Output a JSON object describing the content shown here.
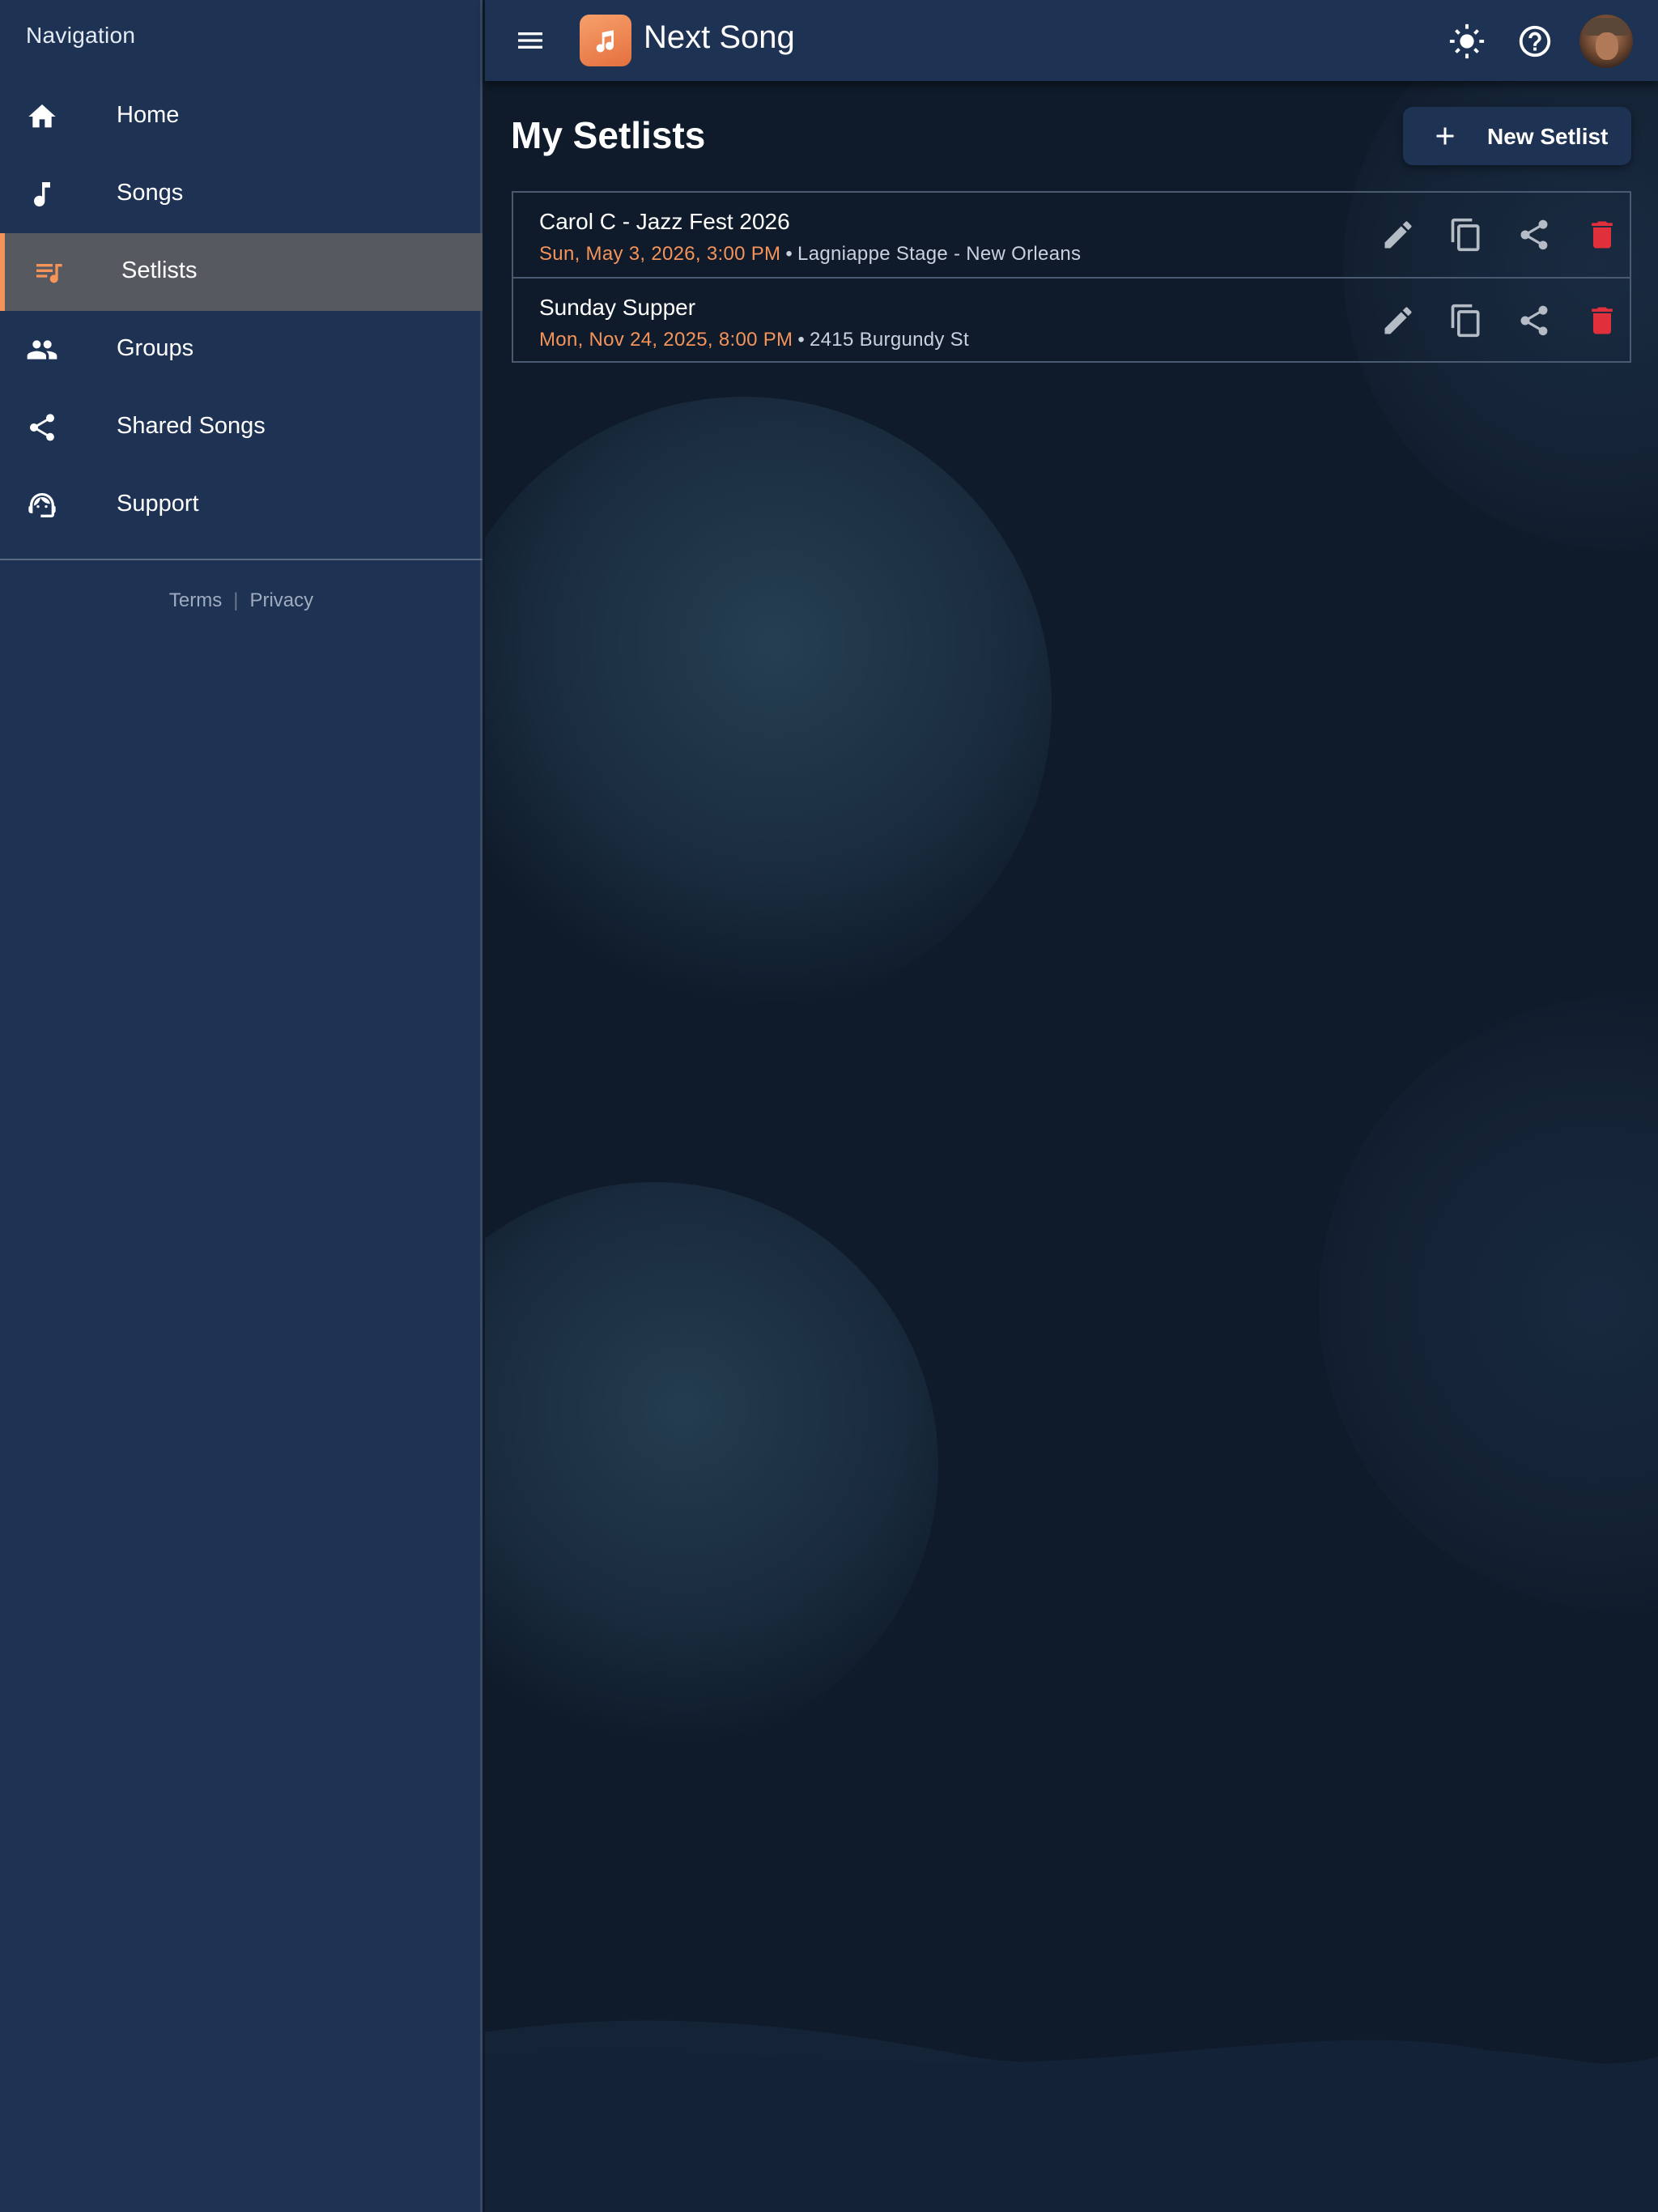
{
  "sidebar": {
    "title": "Navigation",
    "items": [
      {
        "label": "Home",
        "icon": "home-icon"
      },
      {
        "label": "Songs",
        "icon": "music-note-icon"
      },
      {
        "label": "Setlists",
        "icon": "playlist-music-icon",
        "active": true
      },
      {
        "label": "Groups",
        "icon": "people-icon"
      },
      {
        "label": "Shared Songs",
        "icon": "share-icon"
      },
      {
        "label": "Support",
        "icon": "support-agent-icon"
      }
    ],
    "footer": {
      "terms": "Terms",
      "separator": "|",
      "privacy": "Privacy"
    }
  },
  "header": {
    "app_title": "Next Song",
    "icons": [
      "menu-icon",
      "app-logo-icon",
      "theme-toggle-icon",
      "help-icon",
      "avatar"
    ]
  },
  "main": {
    "page_title": "My Setlists",
    "new_button_label": "New Setlist",
    "setlists": [
      {
        "title": "Carol C - Jazz Fest 2026",
        "date": "Sun, May 3, 2026, 3:00 PM",
        "separator": "•",
        "venue": "Lagniappe Stage - New Orleans"
      },
      {
        "title": "Sunday Supper",
        "date": "Mon, Nov 24, 2025, 8:00 PM",
        "separator": "•",
        "venue": "2415 Burgundy St"
      }
    ],
    "row_actions": [
      "edit-icon",
      "copy-icon",
      "share-icon",
      "delete-icon"
    ]
  },
  "colors": {
    "sidebar_bg": "#1e3254",
    "main_bg": "#0f1b2b",
    "accent": "#f4935a",
    "active_item_bg": "#56595f",
    "delete": "#e0303c",
    "action_icon": "#b5bcc6"
  }
}
